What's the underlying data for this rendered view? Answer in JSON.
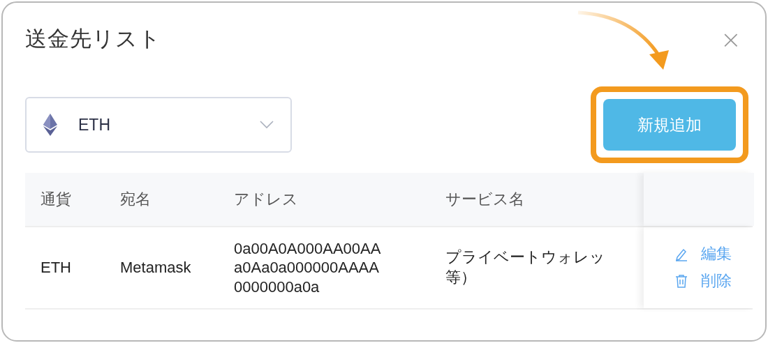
{
  "dialog": {
    "title": "送金先リスト",
    "close": "×"
  },
  "currency_select": {
    "value": "ETH"
  },
  "add_button": {
    "label": "新規追加",
    "highlighted": true
  },
  "table": {
    "columns": [
      "通貨",
      "宛名",
      "アドレス",
      "サービス名"
    ],
    "rows": [
      {
        "currency": "ETH",
        "name": "Metamask",
        "address": "0a00A0A000AA00AA\na0Aa0a000000AAAA\n0000000a0a",
        "service": [
          "プライベートウォレッ",
          "等）"
        ],
        "actions": [
          {
            "kind": "edit",
            "label": "編集"
          },
          {
            "kind": "delete",
            "label": "削除"
          }
        ]
      }
    ]
  }
}
